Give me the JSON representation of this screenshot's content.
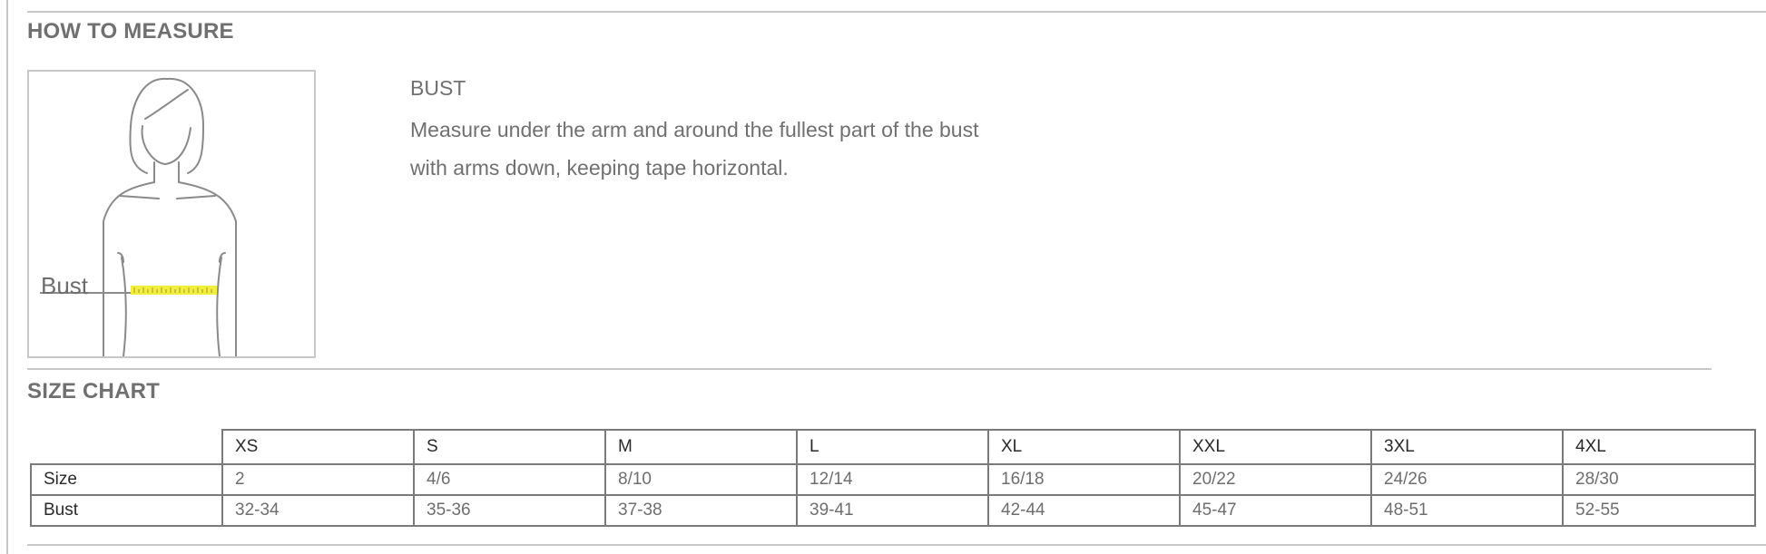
{
  "how_to_measure": {
    "title": "HOW TO MEASURE",
    "figure_label": "Bust",
    "heading": "BUST",
    "line1": "Measure under the arm and around the fullest part of the bust",
    "line2": "with arms down, keeping tape horizontal."
  },
  "size_chart": {
    "title": "SIZE CHART",
    "columns": [
      "XS",
      "S",
      "M",
      "L",
      "XL",
      "XXL",
      "3XL",
      "4XL"
    ],
    "rows": [
      {
        "label": "Size",
        "values": [
          "2",
          "4/6",
          "8/10",
          "12/14",
          "16/18",
          "20/22",
          "24/26",
          "28/30"
        ]
      },
      {
        "label": "Bust",
        "values": [
          "32-34",
          "35-36",
          "37-38",
          "39-41",
          "42-44",
          "45-47",
          "48-51",
          "52-55"
        ]
      }
    ]
  },
  "colors": {
    "text": "#707070",
    "rule": "#c8c8c8",
    "tape": "#f2ee3a"
  },
  "icons": [
    "figure-illustration-icon",
    "measuring-tape-icon"
  ]
}
